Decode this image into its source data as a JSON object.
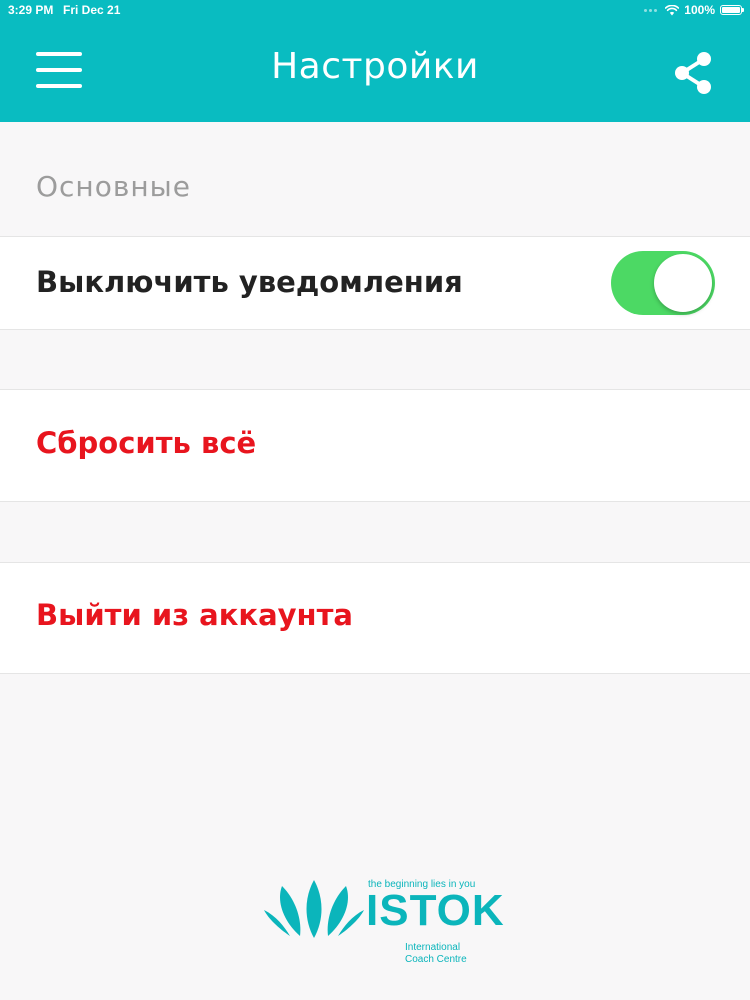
{
  "status_bar": {
    "time": "3:29 PM",
    "date": "Fri Dec 21",
    "battery": "100%",
    "wifi_icon": "wifi-icon",
    "battery_icon": "battery-icon"
  },
  "header": {
    "title": "Настройки",
    "menu_icon": "hamburger-menu-icon",
    "share_icon": "share-icon",
    "background_color": "#09bcc1"
  },
  "settings": {
    "section_title": "Основные",
    "notifications": {
      "label": "Выключить уведомления",
      "toggle_on": true,
      "toggle_color": "#4cd964"
    },
    "reset_label": "Сбросить всё",
    "logout_label": "Выйти из аккаунта",
    "destructive_color": "#e8151e"
  },
  "logo": {
    "tagline": "the beginning lies in you",
    "wordmark": "ISTOK",
    "subtitle_line1": "International",
    "subtitle_line2": "Coach Centre",
    "brand_color": "#0bb5bb"
  }
}
